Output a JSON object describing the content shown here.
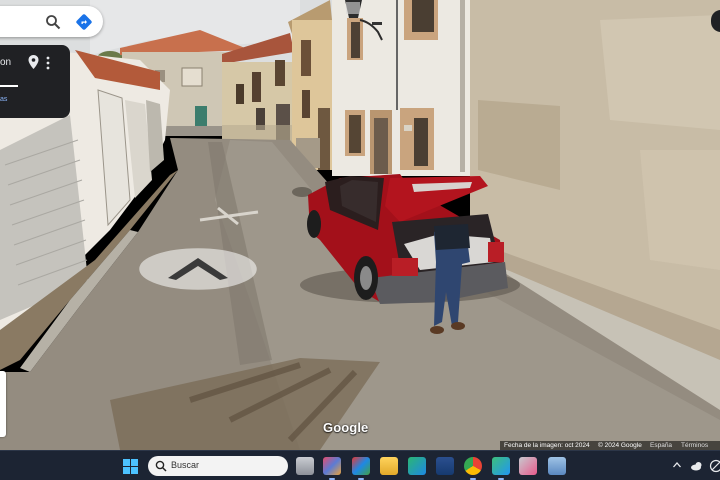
{
  "search_panel": {
    "search_icon": "search-icon",
    "directions_icon": "directions-icon",
    "address_fragment": "on",
    "address_subtext": "as",
    "pin_icon": "location-pin-icon",
    "more_icon": "more-vert-icon"
  },
  "viewer": {
    "brand": "Google",
    "nav_arrow_icon": "chevron-up-icon",
    "footer": {
      "capture_date": "Fecha de la imagen: oct 2024",
      "copyright": "© 2024 Google",
      "country": "España",
      "terms": "Términos"
    }
  },
  "taskbar": {
    "start_icon": "windows-start-icon",
    "search_placeholder": "Buscar",
    "apps": [
      {
        "name": "app-icon-1"
      },
      {
        "name": "app-icon-2"
      },
      {
        "name": "app-icon-3"
      },
      {
        "name": "file-explorer-icon"
      },
      {
        "name": "app-icon-5"
      },
      {
        "name": "app-icon-6"
      },
      {
        "name": "chrome-icon"
      },
      {
        "name": "app-icon-8"
      },
      {
        "name": "app-icon-9"
      },
      {
        "name": "app-icon-10"
      }
    ],
    "tray": [
      "chevron-up-icon",
      "weather-icon",
      "speaker-icon"
    ]
  },
  "colors": {
    "car": "#a3101a",
    "sky": "#dfe1e2",
    "road": "#948c80",
    "taskbar": "#1c2433",
    "accent": "#4cc2ff"
  }
}
